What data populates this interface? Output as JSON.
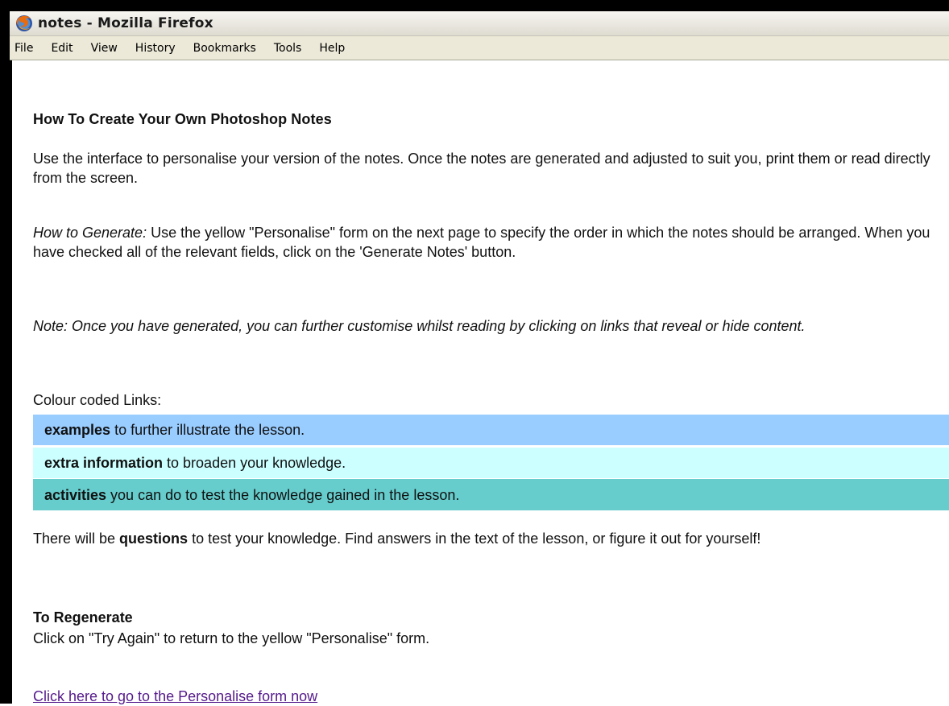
{
  "window": {
    "title": "notes - Mozilla Firefox"
  },
  "menubar": {
    "items": [
      {
        "label": "File"
      },
      {
        "label": "Edit"
      },
      {
        "label": "View"
      },
      {
        "label": "History"
      },
      {
        "label": "Bookmarks"
      },
      {
        "label": "Tools"
      },
      {
        "label": "Help"
      }
    ]
  },
  "page": {
    "heading": "How To Create Your Own Photoshop Notes",
    "intro": "Use the interface to personalise your version of the notes. Once the notes are generated and adjusted to suit you, print them or read directly from the screen.",
    "generate_label": "How to Generate:",
    "generate_text": " Use the yellow \"Personalise\" form on the next page to specify the order in which the notes should be arranged. When you have checked all of the relevant fields, click on the 'Generate Notes' button.",
    "note": "Note: Once you have generated, you can further customise whilst reading by clicking on links that reveal or hide content.",
    "colour_label": "Colour coded Links:",
    "links": [
      {
        "bold": "examples",
        "text": " to further illustrate the lesson.",
        "color": "#99ccff"
      },
      {
        "bold": "extra information",
        "text": " to broaden your knowledge.",
        "color": "#ccffff"
      },
      {
        "bold": "activities",
        "text": " you can do to test the knowledge gained in the lesson.",
        "color": "#66cccc"
      }
    ],
    "questions_pre": "There will be ",
    "questions_bold": "questions",
    "questions_post": " to test your knowledge. Find answers in the text of the lesson, or figure it out for yourself!",
    "regen_title": "To Regenerate",
    "regen_text": "Click on \"Try Again\" to return to the yellow \"Personalise\" form.",
    "personalise_link": "Click here to go to the Personalise form now"
  },
  "colors": {
    "link_visited": "#551a8b",
    "menubar_bg": "#ece9d8"
  }
}
